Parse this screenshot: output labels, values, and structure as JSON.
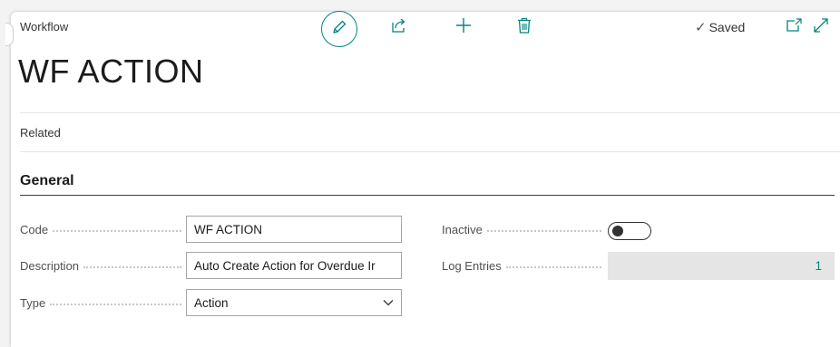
{
  "header": {
    "breadcrumb": "Workflow",
    "saved_label": "Saved"
  },
  "toolbar": {
    "icons": [
      "pencil-edit-icon",
      "share-icon",
      "plus-icon",
      "trash-icon",
      "check-icon",
      "popout-icon",
      "expand-icon"
    ]
  },
  "page": {
    "title": "WF ACTION"
  },
  "menu": {
    "related_label": "Related"
  },
  "section": {
    "title": "General"
  },
  "fields": {
    "code": {
      "label": "Code",
      "value": "WF ACTION"
    },
    "description": {
      "label": "Description",
      "value": "Auto Create Action for Overdue Ir"
    },
    "type": {
      "label": "Type",
      "value": "Action"
    },
    "inactive": {
      "label": "Inactive",
      "value": false
    },
    "log_entries": {
      "label": "Log Entries",
      "value": "1"
    }
  },
  "colors": {
    "accent": "#00857f",
    "background": "#f3f3f3",
    "card": "#ffffff",
    "readonly_field": "#e5e5e5"
  }
}
